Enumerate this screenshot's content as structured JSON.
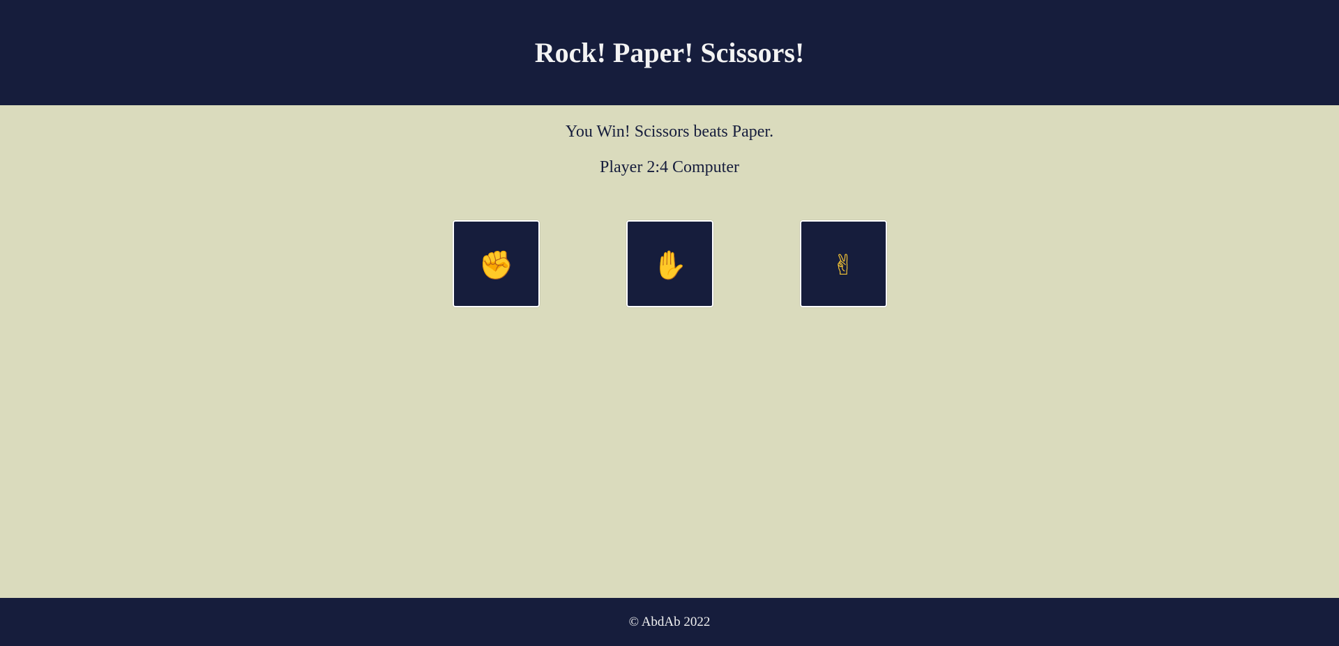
{
  "header": {
    "title": "Rock! Paper! Scissors!"
  },
  "game": {
    "result_text": "You Win! Scissors beats Paper.",
    "score_text": "Player 2:4 Computer"
  },
  "choices": [
    {
      "label": "✊",
      "icon": "rock-fist-icon"
    },
    {
      "label": "✋",
      "icon": "paper-hand-icon"
    },
    {
      "label": "✌",
      "icon": "scissors-victory-hand-icon"
    }
  ],
  "footer": {
    "copyright": "© AbdAb 2022"
  },
  "colors": {
    "navy": "#161d3c",
    "background": "#dadbbd",
    "emoji_yellow": "#f6c535",
    "text_light": "#f3f3f3"
  }
}
